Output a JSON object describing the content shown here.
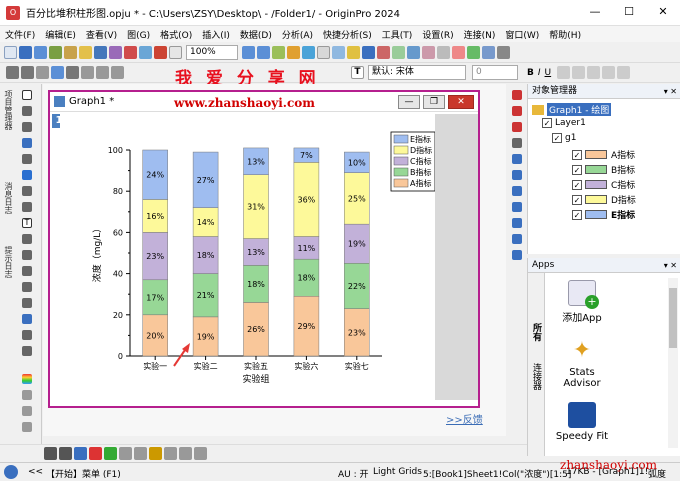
{
  "window": {
    "title": "百分比堆积柱形图.opju * - C:\\Users\\ZSY\\Desktop\\ - /Folder1/ - OriginPro 2024",
    "min": "—",
    "max": "☐",
    "close": "✕"
  },
  "menu": [
    "文件(F)",
    "编辑(E)",
    "查看(V)",
    "图(G)",
    "格式(O)",
    "插入(I)",
    "数据(D)",
    "分析(A)",
    "快捷分析(S)",
    "工具(T)",
    "设置(R)",
    "连接(N)",
    "窗口(W)",
    "帮助(H)"
  ],
  "toolbar": {
    "zoom": "100%",
    "font": "默认: 宋体",
    "size": "0"
  },
  "watermark": {
    "cn": "我 爱 分 享 网",
    "url": "www.zhanshaoyi.com",
    "bottom": "zhanshaoyi.com"
  },
  "left_panels": {
    "p1": "项目管理器",
    "p2": "消息日志",
    "p3": "提示日志"
  },
  "graph_window": {
    "title": "Graph1 *",
    "layer_badge": "1"
  },
  "chart_data": {
    "type": "bar",
    "stacked": true,
    "percent": true,
    "categories": [
      "实验一",
      "实验二",
      "实验五",
      "实验六",
      "实验七"
    ],
    "series": [
      {
        "name": "A指标",
        "color": "#f9c79a",
        "values": [
          20,
          19,
          26,
          29,
          23
        ],
        "labels": [
          "20%",
          "19%",
          "26%",
          "29%",
          "23%"
        ]
      },
      {
        "name": "B指标",
        "color": "#97d796",
        "values": [
          17,
          21,
          18,
          18,
          22
        ],
        "labels": [
          "17%",
          "21%",
          "18%",
          "18%",
          "22%"
        ]
      },
      {
        "name": "C指标",
        "color": "#c2b1d9",
        "values": [
          23,
          18,
          13,
          11,
          19
        ],
        "labels": [
          "23%",
          "18%",
          "13%",
          "11%",
          "19%"
        ]
      },
      {
        "name": "D指标",
        "color": "#fdf99a",
        "values": [
          16,
          14,
          31,
          36,
          25
        ],
        "labels": [
          "16%",
          "14%",
          "31%",
          "36%",
          "25%"
        ]
      },
      {
        "name": "E指标",
        "color": "#9fbdf0",
        "values": [
          24,
          27,
          13,
          7,
          10
        ],
        "labels": [
          "24%",
          "27%",
          "13%",
          "7%",
          "10%"
        ]
      }
    ],
    "xlabel": "实验组",
    "ylabel": "浓度（mg/L）",
    "ylim": [
      0,
      100
    ],
    "yticks": [
      "0",
      "20",
      "40",
      "60",
      "80",
      "100"
    ],
    "legend_placement": "top-right"
  },
  "feedback_link": ">>反馈",
  "object_manager": {
    "title": "对象管理器",
    "graph": "Graph1 - 绘图",
    "layer": "Layer1",
    "group": "g1",
    "items": [
      "A指标",
      "B指标",
      "C指标",
      "D指标",
      "E指标"
    ]
  },
  "apps": {
    "title": "Apps",
    "tabs": [
      "所有",
      "连接器"
    ],
    "items": [
      "添加App",
      "Stats Advisor",
      "Speedy Fit"
    ]
  },
  "status": {
    "left": "<<",
    "start": "【开始】菜单 (F1)",
    "au": "AU : 开",
    "grids": "Light Grids",
    "cell": "5:[Book1]Sheet1!Col(\"浓度\")[1:5]",
    "size": "17KB - [Graph1]1!",
    "unit": "弧度"
  }
}
